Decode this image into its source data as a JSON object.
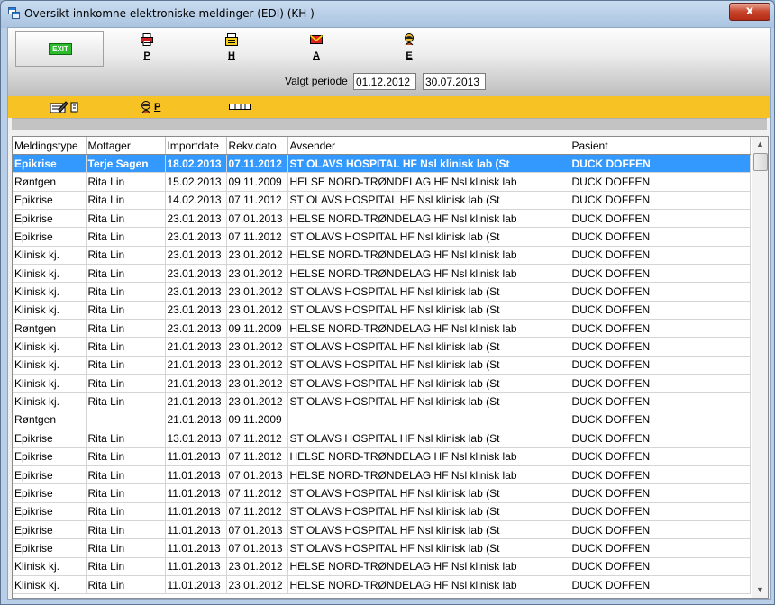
{
  "window": {
    "title": "Oversikt innkomne elektroniske meldinger (EDI) (KH  )",
    "close_label": "x"
  },
  "toolbar": {
    "exit_label": "EXIT",
    "buttons": [
      {
        "label": "P",
        "icon": "printer-icon"
      },
      {
        "label": "H",
        "icon": "document-stack-icon"
      },
      {
        "label": "A",
        "icon": "envelope-icon"
      },
      {
        "label": "E",
        "icon": "person-icon"
      }
    ],
    "period_label": "Valgt periode",
    "date_from": "01.12.2012",
    "date_to": "30.07.2013"
  },
  "subtoolbar": {
    "p_label": "P"
  },
  "table": {
    "columns": [
      "Meldingstype",
      "Mottager",
      "Importdate",
      "Rekv.dato",
      "Avsender",
      "Pasient"
    ],
    "selected_row": 0,
    "rows": [
      [
        "Epikrise",
        "Terje Sagen",
        "18.02.2013",
        "07.11.2012",
        "ST OLAVS HOSPITAL HF Nsl klinisk lab (St",
        "DUCK DOFFEN"
      ],
      [
        "Røntgen",
        "Rita Lin",
        "15.02.2013",
        "09.11.2009",
        "HELSE NORD-TRØNDELAG HF Nsl klinisk lab",
        "DUCK DOFFEN"
      ],
      [
        "Epikrise",
        "Rita Lin",
        "14.02.2013",
        "07.11.2012",
        "ST OLAVS HOSPITAL HF Nsl klinisk lab (St",
        "DUCK DOFFEN"
      ],
      [
        "Epikrise",
        "Rita Lin",
        "23.01.2013",
        "07.01.2013",
        "HELSE NORD-TRØNDELAG HF Nsl klinisk lab",
        "DUCK DOFFEN"
      ],
      [
        "Epikrise",
        "Rita Lin",
        "23.01.2013",
        "07.11.2012",
        "ST OLAVS HOSPITAL HF Nsl klinisk lab (St",
        "DUCK DOFFEN"
      ],
      [
        "Klinisk kj.",
        "Rita Lin",
        "23.01.2013",
        "23.01.2012",
        "HELSE NORD-TRØNDELAG HF Nsl klinisk lab",
        "DUCK DOFFEN"
      ],
      [
        "Klinisk kj.",
        "Rita Lin",
        "23.01.2013",
        "23.01.2012",
        "HELSE NORD-TRØNDELAG HF Nsl klinisk lab",
        "DUCK DOFFEN"
      ],
      [
        "Klinisk kj.",
        "Rita Lin",
        "23.01.2013",
        "23.01.2012",
        "ST OLAVS HOSPITAL HF Nsl klinisk lab (St",
        "DUCK DOFFEN"
      ],
      [
        "Klinisk kj.",
        "Rita Lin",
        "23.01.2013",
        "23.01.2012",
        "ST OLAVS HOSPITAL HF Nsl klinisk lab (St",
        "DUCK DOFFEN"
      ],
      [
        "Røntgen",
        "Rita Lin",
        "23.01.2013",
        "09.11.2009",
        "HELSE NORD-TRØNDELAG HF Nsl klinisk lab",
        "DUCK DOFFEN"
      ],
      [
        "Klinisk kj.",
        "Rita Lin",
        "21.01.2013",
        "23.01.2012",
        "ST OLAVS HOSPITAL HF Nsl klinisk lab (St",
        "DUCK DOFFEN"
      ],
      [
        "Klinisk kj.",
        "Rita Lin",
        "21.01.2013",
        "23.01.2012",
        "ST OLAVS HOSPITAL HF Nsl klinisk lab (St",
        "DUCK DOFFEN"
      ],
      [
        "Klinisk kj.",
        "Rita Lin",
        "21.01.2013",
        "23.01.2012",
        "ST OLAVS HOSPITAL HF Nsl klinisk lab (St",
        "DUCK DOFFEN"
      ],
      [
        "Klinisk kj.",
        "Rita Lin",
        "21.01.2013",
        "23.01.2012",
        "ST OLAVS HOSPITAL HF Nsl klinisk lab (St",
        "DUCK DOFFEN"
      ],
      [
        "Røntgen",
        "",
        "21.01.2013",
        "09.11.2009",
        "",
        "DUCK DOFFEN"
      ],
      [
        "Epikrise",
        "Rita Lin",
        "13.01.2013",
        "07.11.2012",
        "ST OLAVS HOSPITAL HF Nsl klinisk lab (St",
        "DUCK DOFFEN"
      ],
      [
        "Epikrise",
        "Rita Lin",
        "11.01.2013",
        "07.11.2012",
        "HELSE NORD-TRØNDELAG HF Nsl klinisk lab",
        "DUCK DOFFEN"
      ],
      [
        "Epikrise",
        "Rita Lin",
        "11.01.2013",
        "07.01.2013",
        "HELSE NORD-TRØNDELAG HF Nsl klinisk lab",
        "DUCK DOFFEN"
      ],
      [
        "Epikrise",
        "Rita Lin",
        "11.01.2013",
        "07.11.2012",
        "ST OLAVS HOSPITAL HF Nsl klinisk lab (St",
        "DUCK DOFFEN"
      ],
      [
        "Epikrise",
        "Rita Lin",
        "11.01.2013",
        "07.11.2012",
        "ST OLAVS HOSPITAL HF Nsl klinisk lab (St",
        "DUCK DOFFEN"
      ],
      [
        "Epikrise",
        "Rita Lin",
        "11.01.2013",
        "07.01.2013",
        "ST OLAVS HOSPITAL HF Nsl klinisk lab (St",
        "DUCK DOFFEN"
      ],
      [
        "Epikrise",
        "Rita Lin",
        "11.01.2013",
        "07.01.2013",
        "ST OLAVS HOSPITAL HF Nsl klinisk lab (St",
        "DUCK DOFFEN"
      ],
      [
        "Klinisk kj.",
        "Rita Lin",
        "11.01.2013",
        "23.01.2012",
        "HELSE NORD-TRØNDELAG HF Nsl klinisk lab",
        "DUCK DOFFEN"
      ],
      [
        "Klinisk kj.",
        "Rita Lin",
        "11.01.2013",
        "23.01.2012",
        "HELSE NORD-TRØNDELAG HF Nsl klinisk lab",
        "DUCK DOFFEN"
      ]
    ]
  },
  "colors": {
    "selection": "#3399ff",
    "yellow_bar": "#f7c224",
    "exit_green": "#2dbb2d"
  }
}
